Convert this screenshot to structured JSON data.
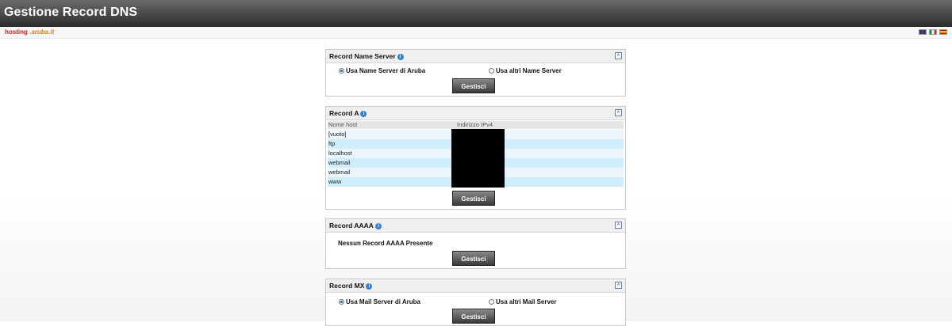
{
  "header": {
    "title": "Gestione Record DNS"
  },
  "brand": {
    "part1": "hosting",
    "part2": ".aruba.it"
  },
  "languages": [
    "english-flag-icon",
    "italian-flag-icon",
    "spanish-flag-icon"
  ],
  "ns": {
    "title": "Record Name Server",
    "opt1": "Usa Name Server di Aruba",
    "opt2": "Usa altri Name Server",
    "selected": "opt1",
    "button": "Gestisci"
  },
  "a": {
    "title": "Record A",
    "col1": "Nome host",
    "col2": "Indirizzo IPv4",
    "rows": [
      "[vuoto]",
      "ftp",
      "localhost",
      "webmail",
      "webmail",
      "www"
    ],
    "button": "Gestisci"
  },
  "aaaa": {
    "title": "Record AAAA",
    "message": "Nessun Record AAAA Presente",
    "button": "Gestisci"
  },
  "mx": {
    "title": "Record MX",
    "opt1": "Usa Mail Server di Aruba",
    "opt2": "Usa altri Mail Server",
    "selected": "opt1",
    "button": "Gestisci"
  },
  "colors": {
    "accent": "#3a7fd5",
    "row_alt": "#cfeefb",
    "row": "#eaf6fb"
  }
}
